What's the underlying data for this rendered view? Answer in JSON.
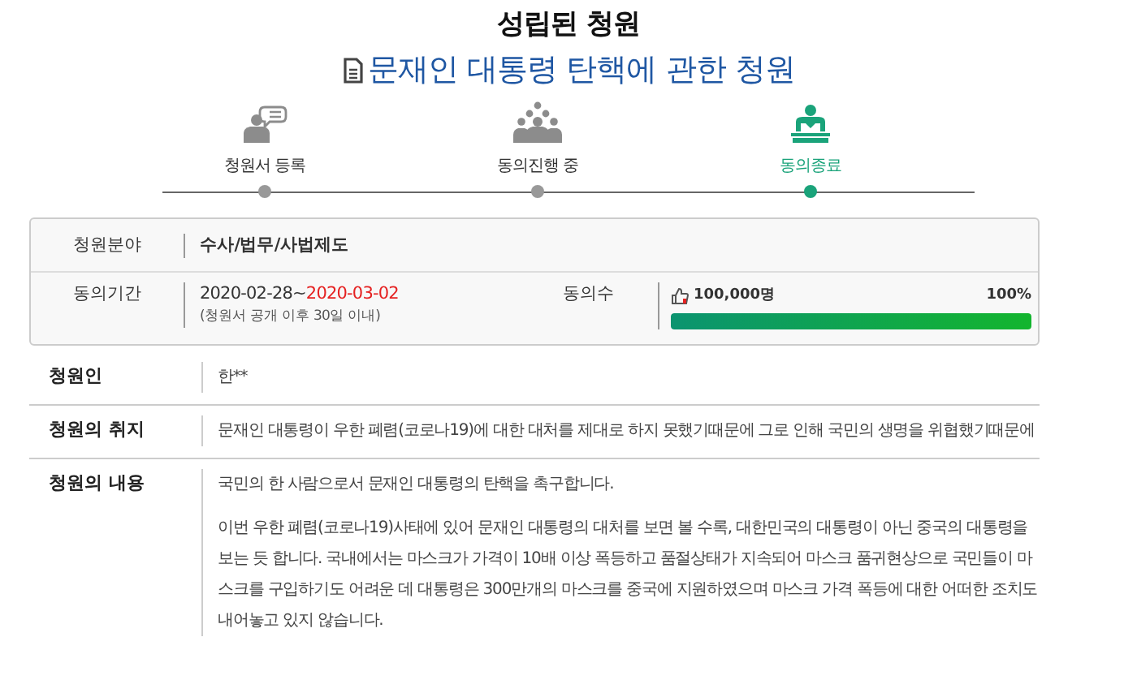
{
  "page_title": "성립된 청원",
  "petition_title": "문재인 대통령 탄핵에 관한 청원",
  "steps": [
    {
      "label": "청원서 등록",
      "kind": "speech",
      "selected": false
    },
    {
      "label": "동의진행 중",
      "kind": "crowd",
      "selected": false
    },
    {
      "label": "동의종료",
      "kind": "podium",
      "selected": true
    }
  ],
  "summary": {
    "category_label": "청원분야",
    "category": "수사/법무/사법제도",
    "period_label": "동의기간",
    "period_start": "2020-02-28~",
    "period_end": "2020-03-02",
    "period_note": "(청원서 공개 이후 30일 이내)",
    "count_label": "동의수",
    "count": "100,000명",
    "percent": "100%",
    "level": 1
  },
  "details": [
    {
      "label": "청원인",
      "paragraphs": [
        "한**"
      ]
    },
    {
      "label": "청원의 취지",
      "paragraphs": [
        "문재인 대통령이 우한 폐렴(코로나19)에 대한 대처를 제대로 하지 못했기때문에 그로 인해 국민의 생명을 위협했기때문에"
      ]
    },
    {
      "label": "청원의 내용",
      "paragraphs": [
        "국민의 한 사람으로서 문재인 대통령의 탄핵을 촉구합니다.",
        "이번 우한 폐렴(코로나19)사태에 있어 문재인 대통령의 대처를 보면 볼 수록, 대한민국의 대통령이 아닌 중국의 대통령을 보는 듯 합니다. 국내에서는 마스크가 가격이 10배 이상 폭등하고 품절상태가 지속되어 마스크 품귀현상으로 국민들이 마스크를 구입하기도 어려운 데 대통령은 300만개의 마스크를 중국에 지원하였으며 마스크 가격 폭등에 대한 어떠한 조치도 내어놓고 있지 않습니다."
      ]
    }
  ]
}
